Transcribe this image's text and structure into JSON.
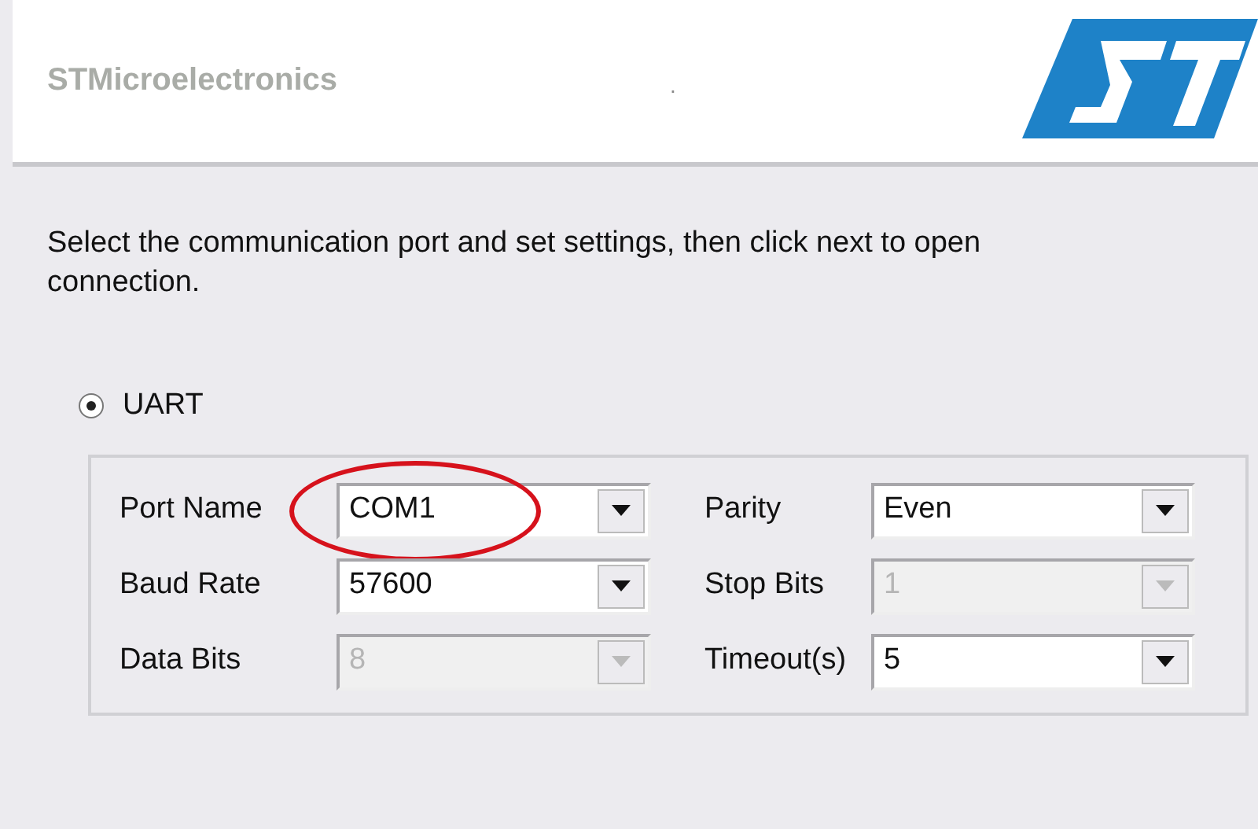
{
  "header": {
    "company": "STMicroelectronics",
    "dot": "."
  },
  "instruction": "Select the communication port and set settings, then click next to open connection.",
  "interface": {
    "label": "UART",
    "selected": true
  },
  "settings": [
    {
      "label": "Port Name",
      "value": "COM1",
      "disabled": false,
      "highlighted": true
    },
    {
      "label": "Parity",
      "value": "Even",
      "disabled": false,
      "highlighted": false
    },
    {
      "label": "Baud Rate",
      "value": "57600",
      "disabled": false,
      "highlighted": false
    },
    {
      "label": "Stop Bits",
      "value": "1",
      "disabled": true,
      "highlighted": false
    },
    {
      "label": "Data Bits",
      "value": "8",
      "disabled": true,
      "highlighted": false
    },
    {
      "label": "Timeout(s)",
      "value": "5",
      "disabled": false,
      "highlighted": false
    }
  ]
}
